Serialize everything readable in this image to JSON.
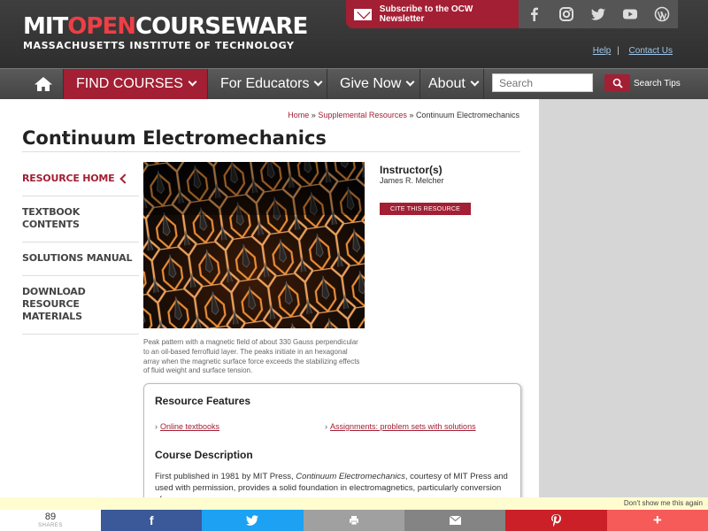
{
  "header": {
    "logo_part1": "MIT",
    "logo_part2": "OPEN",
    "logo_part3": "COURSEWARE",
    "logo_sub": "MASSACHUSETTS INSTITUTE OF TECHNOLOGY",
    "newsletter_label": "Subscribe to the OCW Newsletter",
    "help_link": "Help",
    "links_separator": "|",
    "contact_link": "Contact Us"
  },
  "nav": {
    "find_courses": "FIND COURSES",
    "educators": "For Educators",
    "give_now": "Give Now",
    "about": "About",
    "search_placeholder": "Search",
    "search_tips": "Search Tips"
  },
  "breadcrumb": {
    "home": "Home",
    "sep1": "»",
    "supplemental": "Supplemental Resources",
    "sep2": "»",
    "current": "Continuum Electromechanics"
  },
  "page_title": "Continuum Electromechanics",
  "leftnav": {
    "items": [
      {
        "label": "RESOURCE HOME"
      },
      {
        "label": "TEXTBOOK CONTENTS"
      },
      {
        "label": "SOLUTIONS MANUAL"
      },
      {
        "label": "DOWNLOAD RESOURCE MATERIALS"
      }
    ]
  },
  "hero": {
    "caption": "Peak pattern with a magnetic field of about 330 Gauss perpendicular to an oil-based ferrofluid layer. The peaks initiate in an hexagonal array when the magnetic surface force exceeds the stabilizing effects of fluid weight and surface tension."
  },
  "instructor": {
    "heading": "Instructor(s)",
    "name": "James R. Melcher",
    "cite_button": "CITE THIS RESOURCE"
  },
  "features": {
    "heading": "Resource Features",
    "link1": "Online textbooks",
    "link2": "Assignments: problem sets with solutions",
    "desc_heading": "Course Description",
    "desc_pre": "First published in 1981 by MIT Press, ",
    "desc_italic": "Continuum Electromechanics",
    "desc_post": ", courtesy of MIT Press and used with permission, provides a solid foundation in electromagnetics, particularly conversion of"
  },
  "share": {
    "dont_show": "Don't show me this again",
    "count": "89",
    "count_label": "SHARES",
    "colors": {
      "facebook": "#3b5998",
      "twitter": "#1da1f2",
      "print": "#a0a0a0",
      "email": "#848484",
      "pinterest": "#cb2027",
      "more": "#f65a59"
    }
  },
  "colors": {
    "brand_red": "#a31f34",
    "logo_red": "#ee3e46"
  }
}
